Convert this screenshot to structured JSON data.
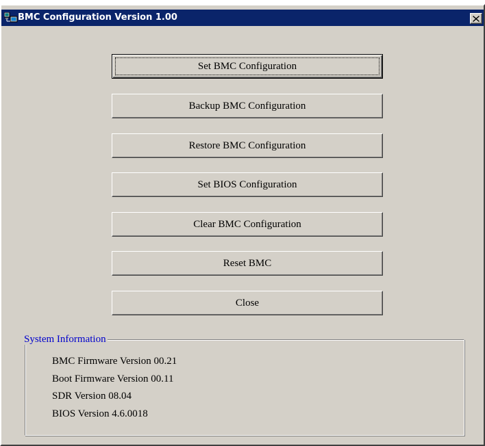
{
  "window": {
    "title": "BMC Configuration Version 1.00",
    "icon": "computer-network-icon",
    "close_icon": "close-icon"
  },
  "buttons": [
    {
      "label": "Set BMC Configuration"
    },
    {
      "label": "Backup BMC Configuration"
    },
    {
      "label": "Restore BMC Configuration"
    },
    {
      "label": "Set BIOS Configuration"
    },
    {
      "label": "Clear BMC Configuration"
    },
    {
      "label": "Reset BMC"
    },
    {
      "label": "Close"
    }
  ],
  "system_info": {
    "title": "System Information",
    "lines": [
      "BMC Firmware Version 00.21",
      "Boot Firmware Version 00.11",
      "SDR Version 08.04",
      "BIOS Version 4.6.0018"
    ]
  },
  "colors": {
    "titlebar": "#0a246a",
    "face": "#d4d0c8",
    "group_label": "#0000cc"
  }
}
